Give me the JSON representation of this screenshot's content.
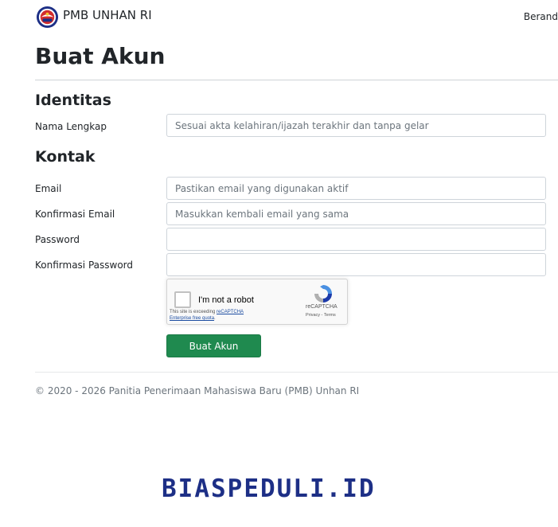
{
  "navbar": {
    "brand": "PMB UNHAN RI",
    "nav_link": "Berand",
    "logo_icon": "unhan-emblem-icon"
  },
  "page": {
    "title": "Buat Akun"
  },
  "sections": {
    "identitas": "Identitas",
    "kontak": "Kontak"
  },
  "form": {
    "nama_lengkap": {
      "label": "Nama Lengkap",
      "value": "",
      "placeholder": "Sesuai akta kelahiran/ijazah terakhir dan tanpa gelar"
    },
    "email": {
      "label": "Email",
      "value": "",
      "placeholder": "Pastikan email yang digunakan aktif"
    },
    "konfirmasi_email": {
      "label": "Konfirmasi Email",
      "value": "",
      "placeholder": "Masukkan kembali email yang sama"
    },
    "password": {
      "label": "Password",
      "value": "",
      "placeholder": ""
    },
    "konfirmasi_password": {
      "label": "Konfirmasi Password",
      "value": "",
      "placeholder": ""
    },
    "submit_label": "Buat Akun"
  },
  "recaptcha": {
    "label": "I'm not a robot",
    "quota_text_1": "This site is exceeding ",
    "quota_link": "reCAPTCHA Enterprise free quota",
    "quota_text_2": ".",
    "brand": "reCAPTCHA",
    "terms": "Privacy - Terms",
    "icon": "recaptcha-icon"
  },
  "footer": {
    "text": "© 2020 - 2026 Panitia Penerimaan Mahasiswa Baru (PMB) Unhan RI"
  },
  "watermark": {
    "text": "BIASPEDULI.ID"
  },
  "colors": {
    "accent_green": "#1f8a4f",
    "watermark_blue": "#1d2f86",
    "muted_text": "#6c757d"
  }
}
